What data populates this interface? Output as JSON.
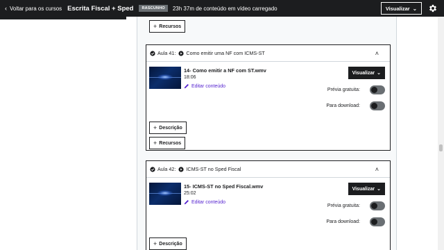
{
  "header": {
    "back_label": "Voltar para os cursos",
    "course_title": "Escrita Fiscal + Sped",
    "status_badge": "RASCUNHO",
    "content_info": "23h 37m de conteúdo em vídeo carregado",
    "preview_label": "Visualizar",
    "settings_icon": "gear-icon"
  },
  "colors": {
    "header_bg": "#1c1d1f",
    "accent_link": "#5624d0",
    "toggle_off": "#6a6f73"
  },
  "top_resources_label": "Recursos",
  "lectures": [
    {
      "number_label": "Aula 41:",
      "title": "Como emitir uma NF com ICMS-ST",
      "file_name": "14- Como emitir a NF com ST.wmv",
      "duration": "18:06",
      "edit_label": "Editar conteúdo",
      "view_label": "Visualizar",
      "free_preview_label": "Prévia gratuita:",
      "free_preview_on": false,
      "download_label": "Para download:",
      "download_on": false,
      "description_label": "Descrição",
      "resources_label": "Recursos"
    },
    {
      "number_label": "Aula 42:",
      "title": "ICMS-ST no Sped Fiscal",
      "file_name": "15- ICMS-ST no Sped Fiscal.wmv",
      "duration": "25:02",
      "edit_label": "Editar conteúdo",
      "view_label": "Visualizar",
      "free_preview_label": "Prévia gratuita:",
      "free_preview_on": false,
      "download_label": "Para download:",
      "download_on": false,
      "description_label": "Descrição"
    }
  ]
}
